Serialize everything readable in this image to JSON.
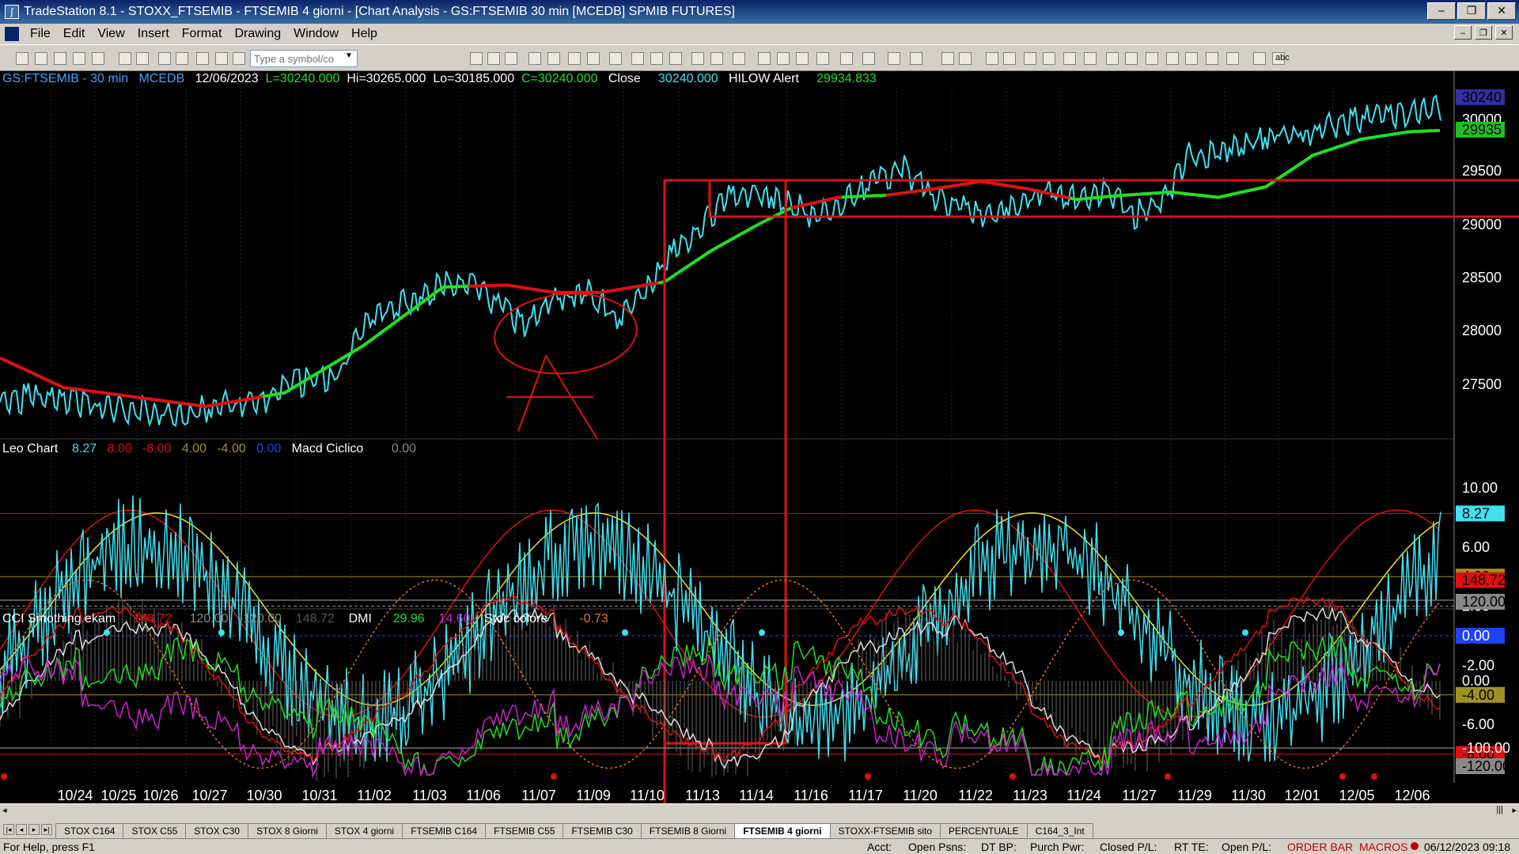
{
  "window": {
    "title": "TradeStation 8.1 - STOXX_FTSEMIB - FTSEMIB  4 giorni - [Chart Analysis - GS:FTSEMIB  30 min  [MCEDB] SPMIB FUTURES]",
    "buttons": [
      "‒",
      "❐",
      "✕"
    ]
  },
  "menu": [
    "File",
    "Edit",
    "View",
    "Insert",
    "Format",
    "Drawing",
    "Window",
    "Help"
  ],
  "toolbar": {
    "symbol_placeholder": "Type a symbol/co",
    "text_tool": "abc"
  },
  "chart_header": {
    "symbol": "GS:FTSEMIB - 30 min",
    "source": "MCEDB",
    "date": "12/06/2023",
    "last": "L=30240.000",
    "high": "Hi=30265.000",
    "low": "Lo=30185.000",
    "close": "C=30240.000",
    "close_label": "Close",
    "close_value": "30240.000",
    "alert_label": "HILOW Alert",
    "alert_value": "29934.833"
  },
  "leo_header": {
    "name": "Leo Chart",
    "v1": "8.27",
    "v2": "8.00",
    "v3": "-8.00",
    "v4": "4.00",
    "v5": "-4.00",
    "v6": "0.00",
    "macd": "Macd Ciclico",
    "macd_val": "0.00"
  },
  "cci_header": {
    "name": "CCI Smothing ekam",
    "v1": "148.72",
    "v2": "120.00",
    "v3": "-120.00",
    "v4": "148.72",
    "dmi": "DMI",
    "dmi1": "29.96",
    "dmi2": "14.60",
    "stoc": "Stoc colore",
    "stoc_val": "-0.73"
  },
  "price_axis": [
    "30240",
    "30000",
    "29935",
    "29500",
    "29000",
    "28500",
    "28000",
    "27500"
  ],
  "leo_axis": [
    "10.00",
    "8.27",
    "6.00",
    "4.00",
    "2.00",
    "0.00",
    "-2.00",
    "-4.00",
    "-6.00",
    "-8.00"
  ],
  "cci_axis": [
    "148.72",
    "120.00",
    "0.00",
    "-100.00",
    "-120.00"
  ],
  "x_labels": [
    "10/24",
    "10/25",
    "10/26",
    "10/27",
    "10/30",
    "10/31",
    "11/02",
    "11/03",
    "11/06",
    "11/07",
    "11/09",
    "11/10",
    "11/13",
    "11/14",
    "11/16",
    "11/17",
    "11/20",
    "11/22",
    "11/23",
    "11/24",
    "11/27",
    "11/29",
    "11/30",
    "12/01",
    "12/05",
    "12/06"
  ],
  "annotation_letter": "A",
  "tabs": [
    "STOX C164",
    "STOX C55",
    "STOX  C30",
    "STOX  8 Giorni",
    "STOX 4 giorni",
    "FTSEMIB C164",
    "FTSEMIB C55",
    "FTSEMIB C30",
    "FTSEMIB  8 Giorni",
    "FTSEMIB  4 giorni",
    "STOXX-FTSEMIB sito",
    "PERCENTUALE",
    "C164_3_Int"
  ],
  "active_tab": "FTSEMIB  4 giorni",
  "status": {
    "help": "For Help, press F1",
    "acct": "Acct:",
    "open_psns": "Open Psns:",
    "dt_bp": "DT BP:",
    "purch_pwr": "Purch Pwr:",
    "closed_pl": "Closed P/L:",
    "rt_te": "RT TE:",
    "open_pl": "Open P/L:",
    "order_bar": "ORDER BAR",
    "macros": "MACROS",
    "datetime": "06/12/2023 09:18"
  },
  "colors": {
    "cyan": "#40e0f0",
    "green": "#20e020",
    "red": "#e01010",
    "yellow": "#f0e020",
    "magenta": "#d020d0",
    "orange": "#e07020",
    "blue": "#1010e0"
  }
}
